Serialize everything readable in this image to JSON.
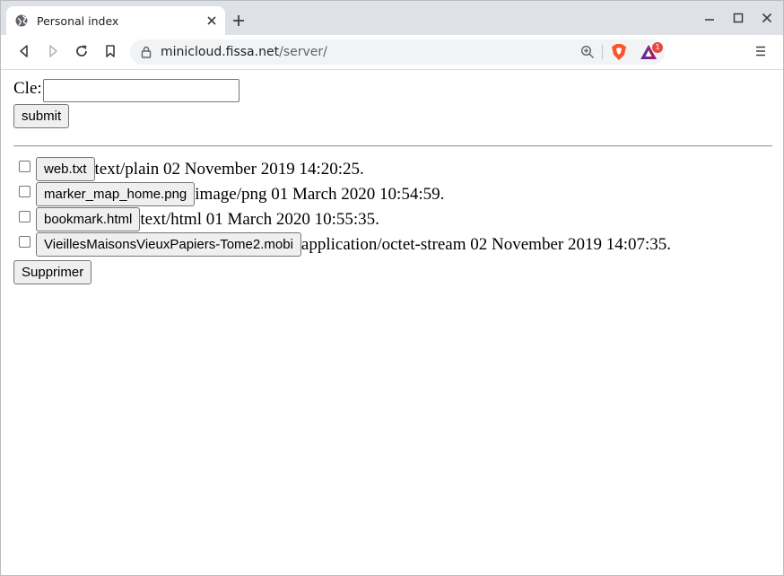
{
  "browser": {
    "tab_title": "Personal index",
    "url_host": "minicloud.fissa.net",
    "url_path": "/server/",
    "rewards_badge": "1"
  },
  "form": {
    "key_label": "Cle:",
    "key_value": "",
    "submit_label": "submit"
  },
  "files": [
    {
      "name": "web.txt",
      "meta": "text/plain 02 November 2019 14:20:25."
    },
    {
      "name": "marker_map_home.png",
      "meta": "image/png 01 March 2020 10:54:59."
    },
    {
      "name": "bookmark.html",
      "meta": "text/html 01 March 2020 10:55:35."
    },
    {
      "name": "VieillesMaisonsVieuxPapiers-Tome2.mobi",
      "meta": "application/octet-stream 02 November 2019 14:07:35."
    }
  ],
  "delete_label": "Supprimer",
  "colors": {
    "brave": "#fb542b",
    "bat": "#9e1f63",
    "badge": "#e8483b"
  }
}
